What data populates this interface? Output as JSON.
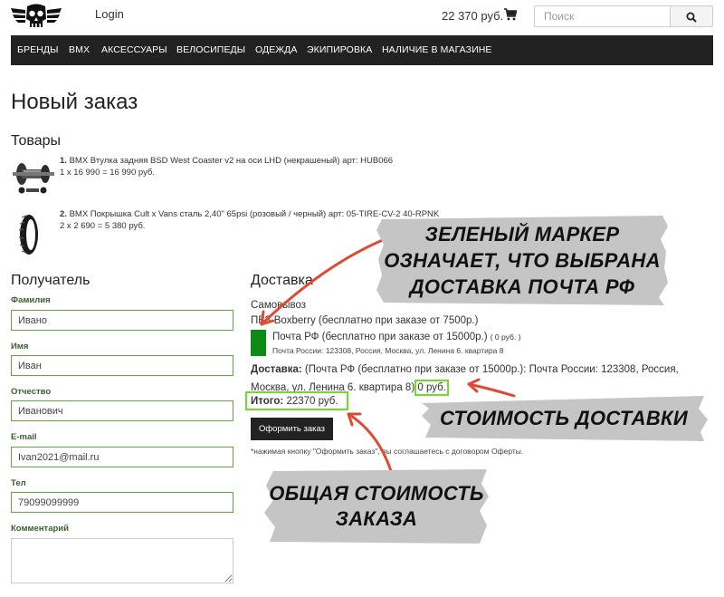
{
  "header": {
    "login": "Login",
    "cart_total": "22 370 руб.",
    "search_placeholder": "Поиск"
  },
  "nav": [
    "БРЕНДЫ",
    "BMX",
    "АКСЕССУАРЫ",
    "ВЕЛОСИПЕДЫ",
    "ОДЕЖДА",
    "ЭКИПИРОВКА",
    "НАЛИЧИЕ В МАГАЗИНЕ"
  ],
  "page_title": "Новый заказ",
  "goods": {
    "title": "Товары",
    "items": [
      {
        "num": "1.",
        "name": "BMX Втулка задняя BSD West Coaster v2 на оси LHD (некрашеный) арт: HUB066",
        "calc": "1 x 16 990 = 16 990 руб."
      },
      {
        "num": "2.",
        "name": "BMX Покрышка Cult x Vans сталь 2,40\" 65psi (розовый / черный) арт: 05-TIRE-CV-2 40-RPNK",
        "calc": "2 x 2 690 = 5 380 руб."
      }
    ]
  },
  "recipient": {
    "title": "Получатель",
    "fields": [
      {
        "label": "Фамилия",
        "value": "Ивано"
      },
      {
        "label": "Имя",
        "value": "Иван"
      },
      {
        "label": "Отчество",
        "value": "Иванович"
      },
      {
        "label": "E-mail",
        "value": "Ivan2021@mail.ru"
      },
      {
        "label": "Тел",
        "value": "79099099999"
      }
    ],
    "comment_label": "Комментарий"
  },
  "delivery": {
    "title": "Доставка",
    "options": [
      "Самовывоз",
      "ПВЗ Boxberry (бесплатно при заказе от 7500р.)",
      "Почта РФ (бесплатно при заказе от 15000р.)"
    ],
    "selected_price": "( 0 руб. )",
    "selected_address": "Почта России: 123308, Россия, Москва, ул. Ленина 6. квартира 8",
    "summary_label": "Доставка:",
    "summary_text": "(Почта РФ (бесплатно при заказе от 15000р.): Почта России: 123308, Россия, Москва, ул. Ленина 6. квартира 8)",
    "summary_price": "0 руб.",
    "total_label": "Итого:",
    "total_value": "22370 руб.",
    "submit": "Оформить заказ",
    "note": "*нажимая кнопку \"Оформить заказ\", вы соглашаетесь с договором Оферты."
  },
  "annotations": {
    "marker_note": [
      "Зеленый маркер",
      "означает, что выбрана",
      "доставка Почта РФ"
    ],
    "delivery_cost": "Стоимость доставки",
    "total_cost": [
      "Общая стоимость",
      "заказа"
    ],
    "arrow_color": "#e04a32",
    "highlight_color": "#6fdc2a",
    "marker_color": "#0d8a14"
  }
}
